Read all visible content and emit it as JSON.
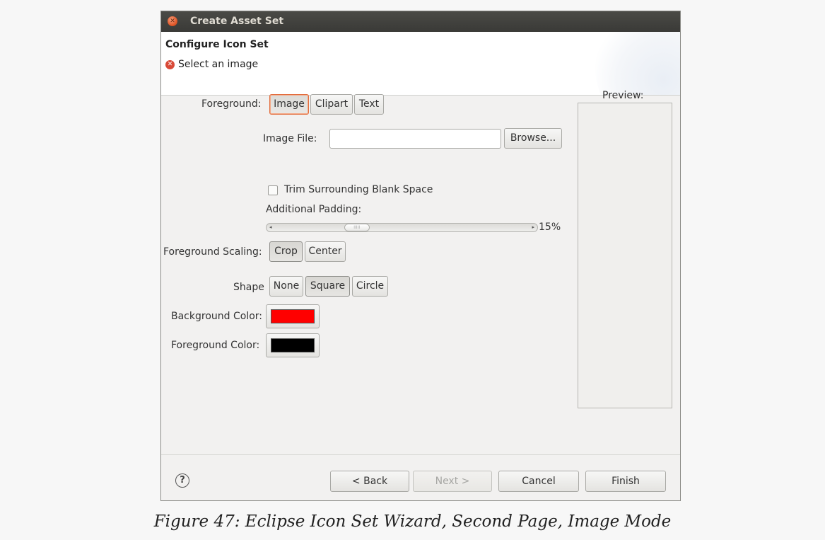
{
  "window": {
    "title": "Create Asset Set",
    "close_icon": "close-icon"
  },
  "header": {
    "title": "Configure Icon Set",
    "message": "Select an image",
    "message_icon": "error-icon"
  },
  "form": {
    "foreground_label": "Foreground:",
    "foreground_options": [
      "Image",
      "Clipart",
      "Text"
    ],
    "foreground_selected": "Image",
    "image_file_label": "Image File:",
    "image_file_value": "",
    "browse_label": "Browse...",
    "trim_label": "Trim Surrounding Blank Space",
    "trim_checked": false,
    "padding_label": "Additional Padding:",
    "padding_value": "15%",
    "padding_fraction": 0.15,
    "scaling_label": "Foreground Scaling:",
    "scaling_options": [
      "Crop",
      "Center"
    ],
    "scaling_selected": "Crop",
    "shape_label": "Shape",
    "shape_options": [
      "None",
      "Square",
      "Circle"
    ],
    "shape_selected": "Square",
    "background_color_label": "Background Color:",
    "background_color": "#ff0000",
    "foreground_color_label": "Foreground Color:",
    "foreground_color": "#000000"
  },
  "preview": {
    "label": "Preview:"
  },
  "footer": {
    "help_icon": "help-icon",
    "back_label": "< Back",
    "next_label": "Next >",
    "cancel_label": "Cancel",
    "finish_label": "Finish"
  },
  "caption": "Figure 47: Eclipse Icon Set Wizard, Second Page, Image Mode"
}
